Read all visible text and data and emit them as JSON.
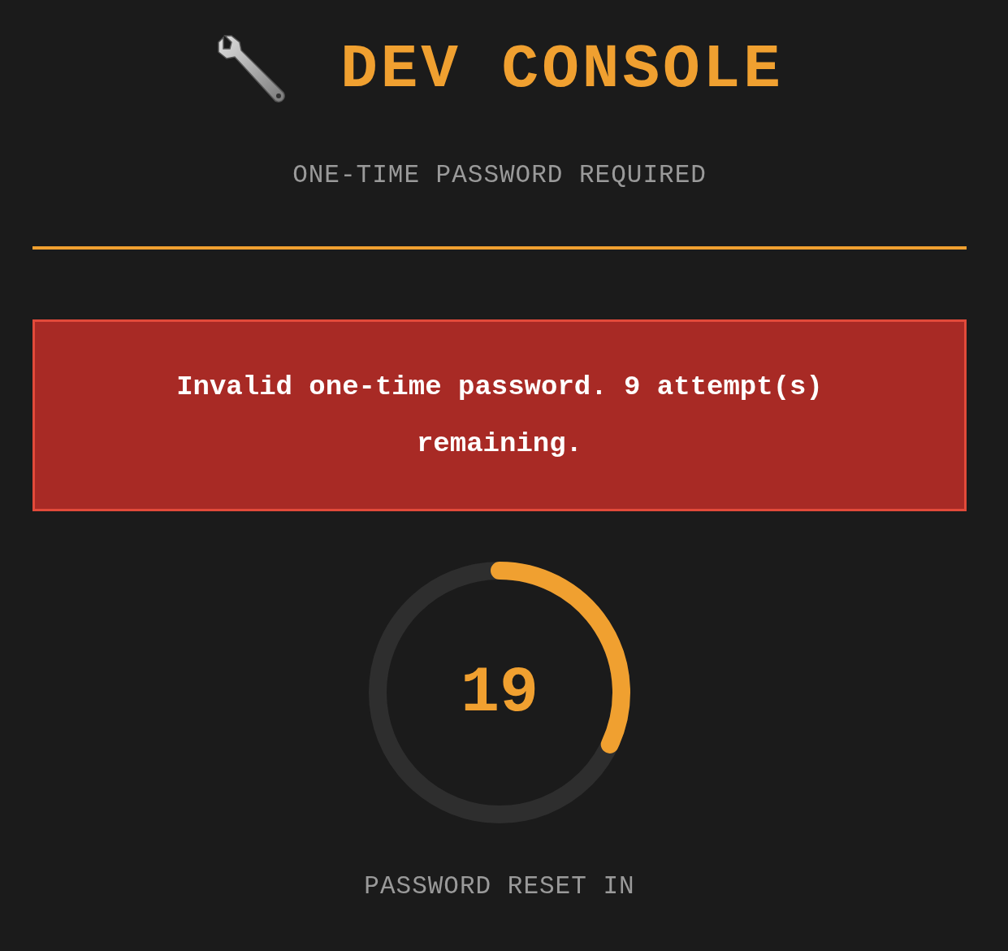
{
  "header": {
    "title": "DEV CONSOLE",
    "subtitle": "ONE-TIME PASSWORD REQUIRED"
  },
  "error": {
    "message": "Invalid one-time password. 9 attempt(s) remaining."
  },
  "timer": {
    "value": "19",
    "label": "PASSWORD RESET IN"
  }
}
